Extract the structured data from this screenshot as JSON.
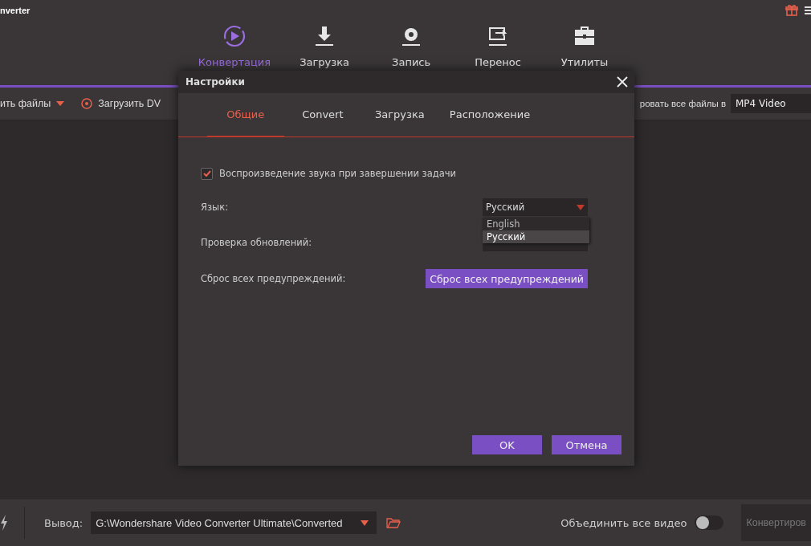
{
  "app": {
    "title": "nverter"
  },
  "nav": [
    {
      "label": "Конвертация",
      "selected": true
    },
    {
      "label": "Загрузка",
      "selected": false
    },
    {
      "label": "Запись",
      "selected": false
    },
    {
      "label": "Перенос",
      "selected": false
    },
    {
      "label": "Утилиты",
      "selected": false
    }
  ],
  "toolbar": {
    "add_files": "ить файлы",
    "load_dvd": "Загрузить DV",
    "convert_all_label": "ровать все файлы в",
    "format": "MP4 Video"
  },
  "dialog": {
    "title": "Настройки",
    "tabs": [
      {
        "label": "Общие",
        "selected": true
      },
      {
        "label": "Convert",
        "selected": false
      },
      {
        "label": "Загрузка",
        "selected": false
      },
      {
        "label": "Расположение",
        "selected": false
      }
    ],
    "sound_option": {
      "label": "Воспроизведение звука при завершении задачи",
      "checked": true
    },
    "language": {
      "label": "Язык:",
      "value": "Русский",
      "options": [
        {
          "label": "English",
          "selected": false
        },
        {
          "label": "Русский",
          "selected": true
        }
      ]
    },
    "updates": {
      "label": "Проверка обновлений:"
    },
    "reset": {
      "label": "Сброс всех предупреждений:",
      "button": "Сброс всех предупреждений"
    },
    "buttons": [
      "OK",
      "Отмена"
    ]
  },
  "bottom_bar": {
    "output_label": "Вывод:",
    "output_path": "G:\\Wondershare Video Converter Ultimate\\Converted",
    "merge_label": "Объединить все видео",
    "merge_on": false,
    "convert_button": "Конвертиров"
  }
}
